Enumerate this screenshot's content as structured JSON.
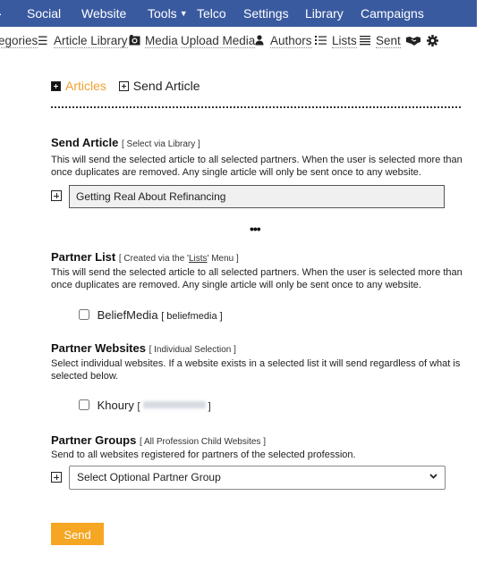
{
  "top_nav": {
    "items": [
      {
        "label": "Social"
      },
      {
        "label": "Website"
      },
      {
        "label": "Tools",
        "has_dropdown": true
      },
      {
        "label": "Telco"
      },
      {
        "label": "Settings"
      },
      {
        "label": "Library"
      },
      {
        "label": "Campaigns"
      }
    ],
    "background_color": "#3a5aa0"
  },
  "sub_nav": {
    "categories_label": "egories",
    "article_library_label": "Article Library",
    "media_label": "Media",
    "upload_media_label": "Upload Media",
    "authors_label": "Authors",
    "lists_label": "Lists",
    "sent_label": "Sent",
    "icons": {
      "menu": "☰",
      "camera": "📷",
      "user": "👤",
      "list": "☷",
      "sent": "☰",
      "handshake": "🤝",
      "gear": "⚙"
    }
  },
  "tabs": {
    "articles_label": "Articles",
    "send_article_label": "Send Article",
    "active_color": "#f0a030"
  },
  "send_article": {
    "title": "Send Article",
    "hint": "[ Select via Library ]",
    "description": "This will send the selected article to all selected partners. When the user is selected more than once duplicates are removed. Any single article will only be sent once to any website.",
    "article_value": "Getting Real About Refinancing"
  },
  "ellipsis": "•••",
  "partner_list": {
    "title": "Partner List",
    "hint_prefix": "[ Created via the '",
    "hint_link": "Lists",
    "hint_suffix": "' Menu ]",
    "description": "This will send the selected article to all selected partners. When the user is selected more than once duplicates are removed. Any single article will only be sent once to any website.",
    "items": [
      {
        "name": "BeliefMedia",
        "slug": "[ beliefmedia ]",
        "checked": false
      }
    ]
  },
  "partner_websites": {
    "title": "Partner Websites",
    "hint": "[ Individual Selection ]",
    "description": "Select individual websites. If a website exists in a selected list it will send regardless of what is selected below.",
    "items": [
      {
        "name": "Khoury",
        "slug_open": "[",
        "slug_close": "]",
        "checked": false
      }
    ]
  },
  "partner_groups": {
    "title": "Partner Groups",
    "hint": "[ All Profession Child Websites ]",
    "description": "Send to all websites registered for partners of the selected profession.",
    "select_value": "Select Optional Partner Group"
  },
  "send_button": {
    "label": "Send",
    "color": "#f5a623"
  }
}
